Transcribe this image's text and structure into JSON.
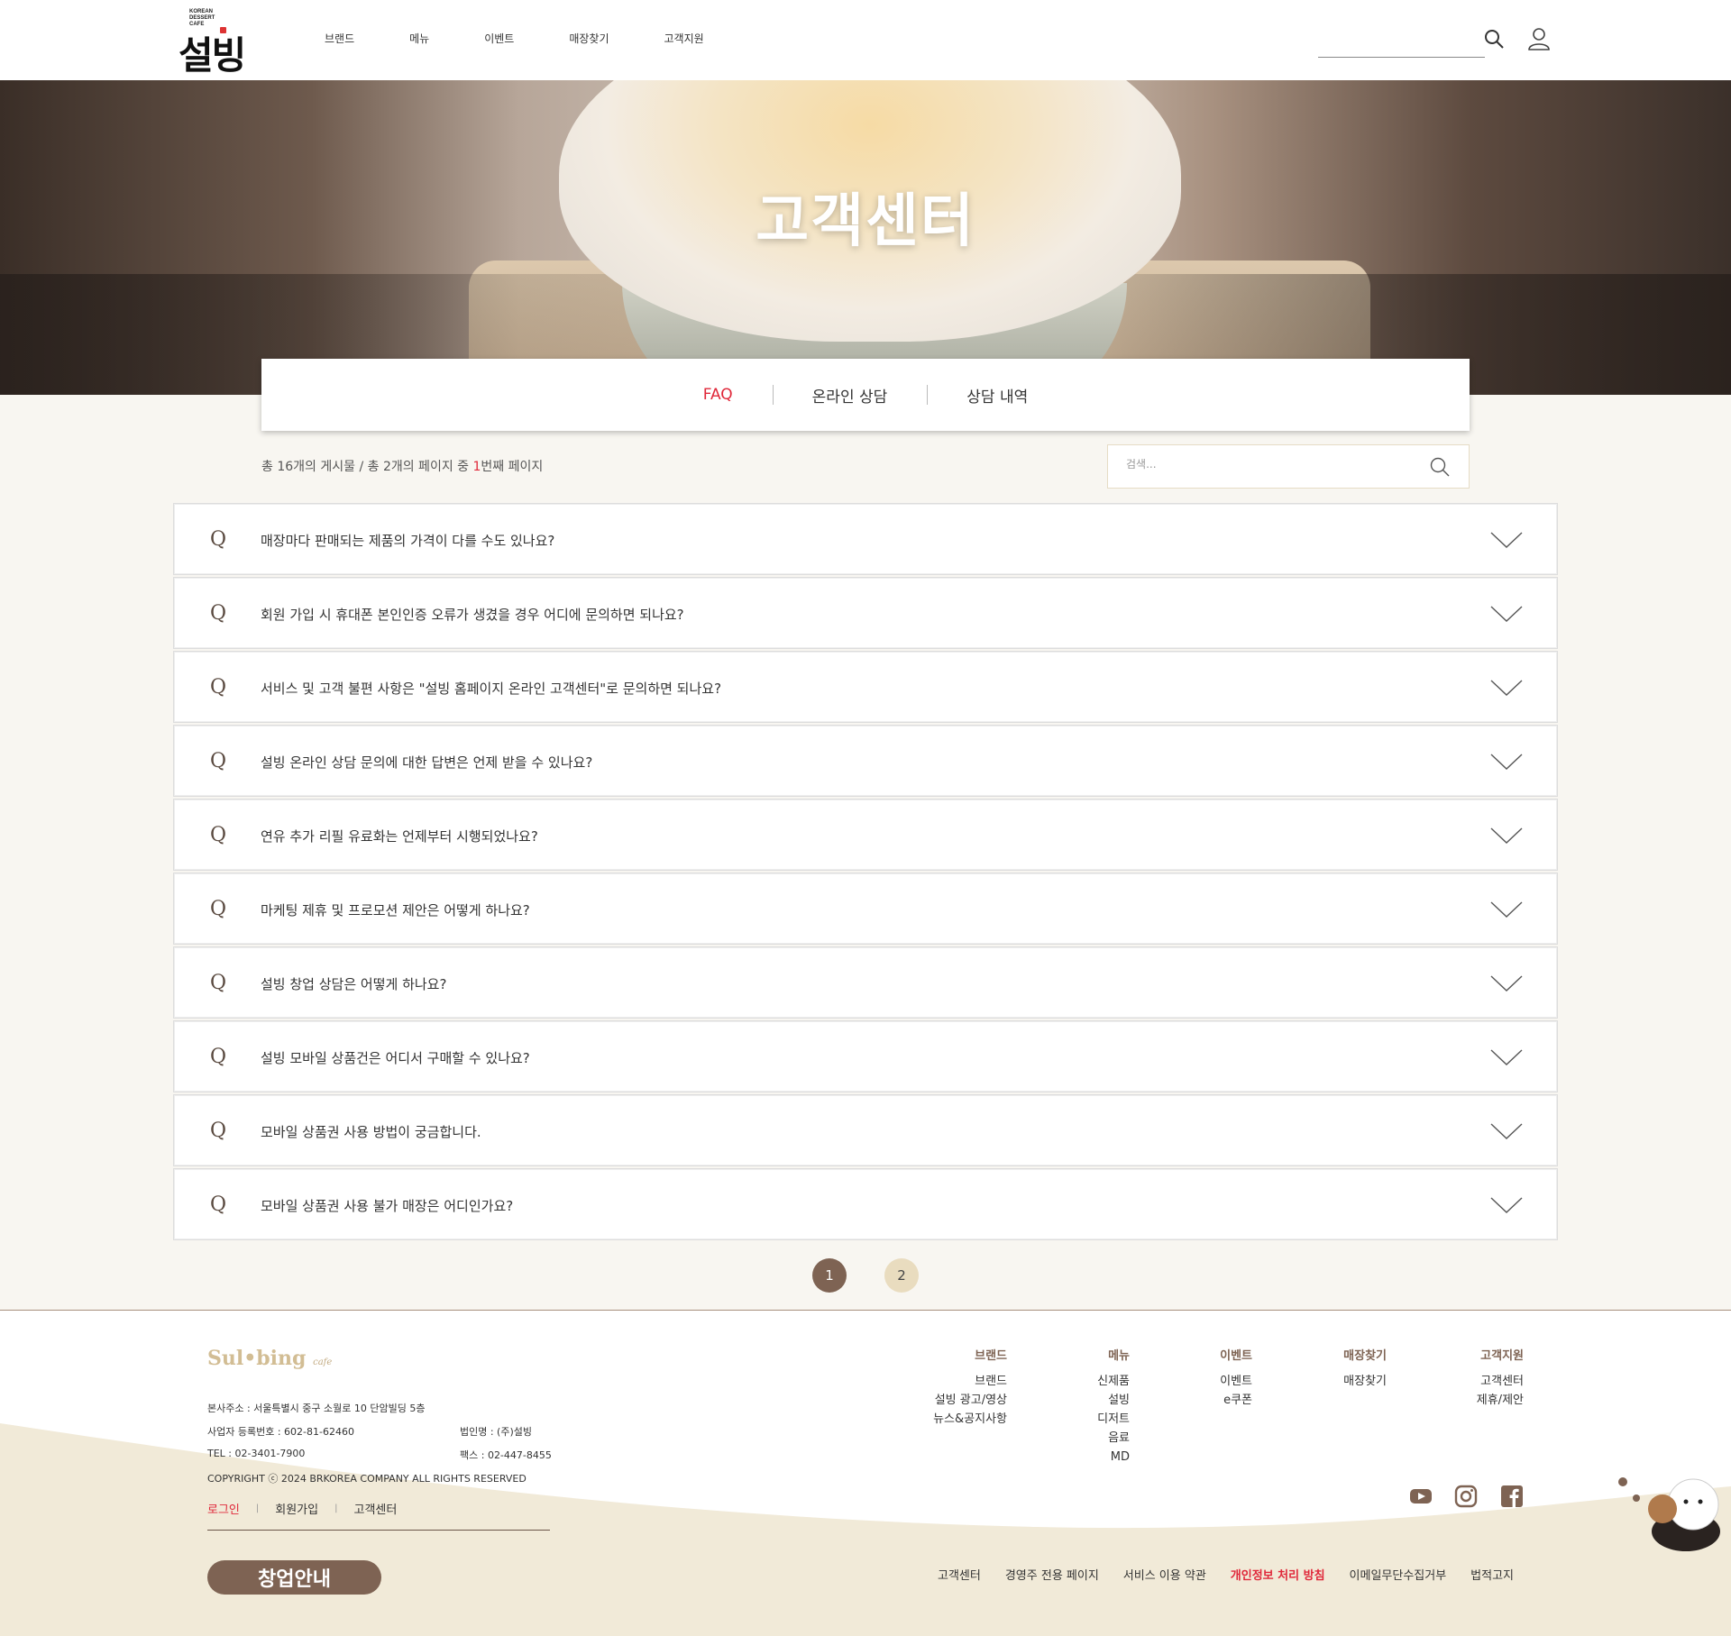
{
  "header": {
    "logo_small": [
      "KOREAN",
      "DESSERT",
      "CAFE"
    ],
    "logo_text": "설빙",
    "nav": [
      "브랜드",
      "메뉴",
      "이벤트",
      "매장찾기",
      "고객지원"
    ]
  },
  "hero": {
    "title": "고객센터"
  },
  "tabs": [
    {
      "label": "FAQ",
      "active": true
    },
    {
      "label": "온라인 상담",
      "active": false
    },
    {
      "label": "상담 내역",
      "active": false
    }
  ],
  "listing": {
    "count_prefix": "총 16개의 게시물 / 총 2개의 페이지 중 ",
    "current_page": "1",
    "count_suffix": "번째 페이지",
    "search_placeholder": "검색..."
  },
  "faq": {
    "q_mark": "Q",
    "items": [
      "매장마다 판매되는 제품의 가격이 다를 수도 있나요?",
      "회원 가입 시 휴대폰 본인인증 오류가 생겼을 경우 어디에 문의하면 되나요?",
      "서비스 및 고객 불편 사항은 \"설빙 홈페이지 온라인 고객센터\"로 문의하면 되나요?",
      "설빙 온라인 상담 문의에 대한 답변은 언제 받을 수 있나요?",
      "연유 추가 리필 유료화는 언제부터 시행되었나요?",
      "마케팅 제휴 및 프로모션 제안은 어떻게 하나요?",
      "설빙 창업 상담은 어떻게 하나요?",
      "설빙 모바일 상품건은 어디서 구매할 수 있나요?",
      "모바일 상품권 사용 방법이 궁금합니다.",
      "모바일 상품권 사용 불가 매장은 어디인가요?"
    ]
  },
  "pagination": {
    "pages": [
      "1",
      "2"
    ],
    "current": "1"
  },
  "footer": {
    "logo": "Sul•bing",
    "logo_suffix": "cafe",
    "address": "본사주소 : 서울특별시 중구 소월로 10 단암빌딩 5층",
    "biz_no": "사업자 등록번호 : 602-81-62460",
    "corp": "법인명 : (주)설빙",
    "tel": "TEL : 02-3401-7900",
    "fax": "팩스 : 02-447-8455",
    "copyright": "COPYRIGHT ⓒ 2024 BRKOREA COMPANY ALL RIGHTS RESERVED",
    "links": {
      "login": "로그인",
      "signup": "회원가입",
      "center": "고객센터"
    },
    "startup": "창업안내",
    "columns": [
      {
        "title": "브랜드",
        "items": [
          "브랜드",
          "설빙 광고/영상",
          "뉴스&공지사항"
        ]
      },
      {
        "title": "메뉴",
        "items": [
          "신제품",
          "설빙",
          "디저트",
          "음료",
          "MD"
        ]
      },
      {
        "title": "이벤트",
        "items": [
          "이벤트",
          "e쿠폰"
        ]
      },
      {
        "title": "매장찾기",
        "items": [
          "매장찾기"
        ]
      },
      {
        "title": "고객지원",
        "items": [
          "고객센터",
          "제휴/제안"
        ]
      }
    ],
    "sns": [
      "youtube-icon",
      "instagram-icon",
      "facebook-icon"
    ],
    "policy": [
      "고객센터",
      "경영주 전용 페이지",
      "서비스 이용 약관",
      "개인정보 처리 방침",
      "이메일무단수집거부",
      "법적고지"
    ]
  },
  "colors": {
    "accent_red": "#e0283a",
    "brand_brown": "#7e6353",
    "beige": "#e9dcbf"
  }
}
